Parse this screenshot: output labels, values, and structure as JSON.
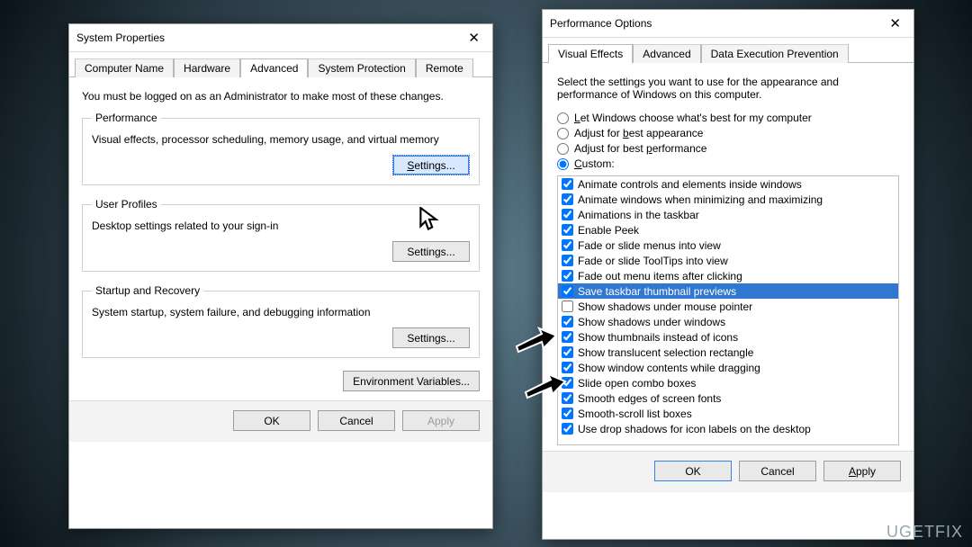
{
  "watermark": "UGETFIX",
  "sysprops": {
    "title": "System Properties",
    "tabs": [
      "Computer Name",
      "Hardware",
      "Advanced",
      "System Protection",
      "Remote"
    ],
    "active_tab": 2,
    "note": "You must be logged on as an Administrator to make most of these changes.",
    "groups": {
      "performance": {
        "legend": "Performance",
        "desc": "Visual effects, processor scheduling, memory usage, and virtual memory",
        "button": "Settings..."
      },
      "userprofiles": {
        "legend": "User Profiles",
        "desc": "Desktop settings related to your sign-in",
        "button": "Settings..."
      },
      "startup": {
        "legend": "Startup and Recovery",
        "desc": "System startup, system failure, and debugging information",
        "button": "Settings..."
      }
    },
    "env_btn": "Environment Variables...",
    "buttons": {
      "ok": "OK",
      "cancel": "Cancel",
      "apply": "Apply"
    }
  },
  "perfopts": {
    "title": "Performance Options",
    "tabs": [
      "Visual Effects",
      "Advanced",
      "Data Execution Prevention"
    ],
    "active_tab": 0,
    "intro": "Select the settings you want to use for the appearance and performance of Windows on this computer.",
    "radios": {
      "let": "Let Windows choose what's best for my computer",
      "best_app": "Adjust for best appearance",
      "best_perf": "Adjust for best performance",
      "custom": "Custom:"
    },
    "selected_radio": "custom",
    "options": [
      {
        "label": "Animate controls and elements inside windows",
        "checked": true
      },
      {
        "label": "Animate windows when minimizing and maximizing",
        "checked": true
      },
      {
        "label": "Animations in the taskbar",
        "checked": true
      },
      {
        "label": "Enable Peek",
        "checked": true
      },
      {
        "label": "Fade or slide menus into view",
        "checked": true
      },
      {
        "label": "Fade or slide ToolTips into view",
        "checked": true
      },
      {
        "label": "Fade out menu items after clicking",
        "checked": true
      },
      {
        "label": "Save taskbar thumbnail previews",
        "checked": true,
        "selected": true
      },
      {
        "label": "Show shadows under mouse pointer",
        "checked": false
      },
      {
        "label": "Show shadows under windows",
        "checked": true
      },
      {
        "label": "Show thumbnails instead of icons",
        "checked": true
      },
      {
        "label": "Show translucent selection rectangle",
        "checked": true
      },
      {
        "label": "Show window contents while dragging",
        "checked": true
      },
      {
        "label": "Slide open combo boxes",
        "checked": true
      },
      {
        "label": "Smooth edges of screen fonts",
        "checked": true
      },
      {
        "label": "Smooth-scroll list boxes",
        "checked": true
      },
      {
        "label": "Use drop shadows for icon labels on the desktop",
        "checked": true
      }
    ],
    "buttons": {
      "ok": "OK",
      "cancel": "Cancel",
      "apply": "Apply"
    }
  }
}
